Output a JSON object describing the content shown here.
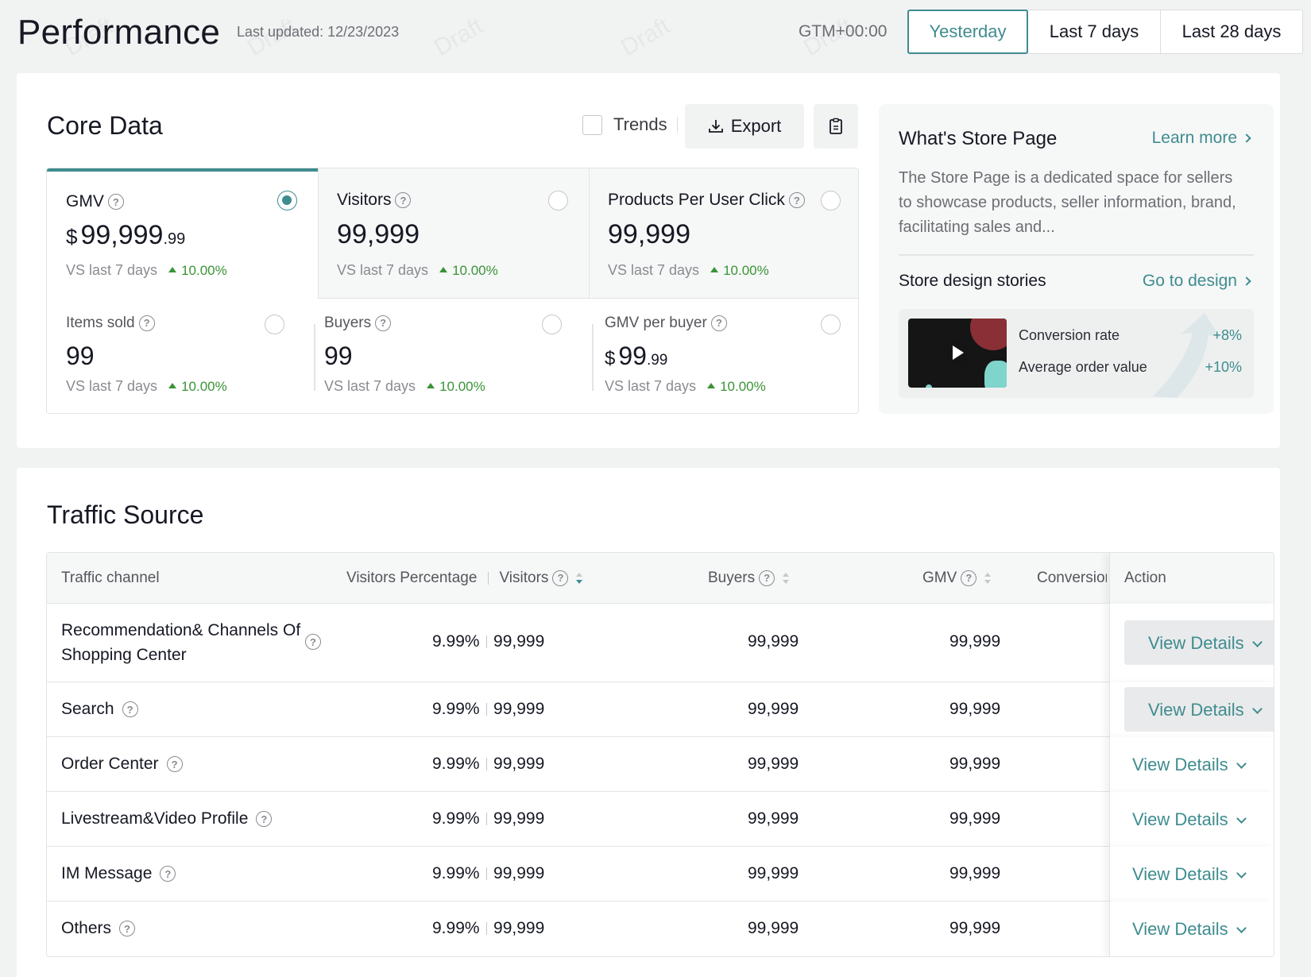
{
  "header": {
    "title": "Performance",
    "last_updated": "Last updated: 12/23/2023",
    "timezone": "GTM+00:00",
    "ranges": [
      "Yesterday",
      "Last 7 days",
      "Last 28 days"
    ],
    "watermark": "Draft"
  },
  "core": {
    "title": "Core Data",
    "trends_label": "Trends",
    "export_label": "Export",
    "metrics": [
      {
        "label": "GMV",
        "currency": "$",
        "value": "99,999",
        "decimal": ".99",
        "compare": "VS last 7 days",
        "change": "10.00%"
      },
      {
        "label": "Visitors",
        "currency": "",
        "value": "99,999",
        "decimal": "",
        "compare": "VS last 7 days",
        "change": "10.00%"
      },
      {
        "label": "Products Per User Click",
        "currency": "",
        "value": "99,999",
        "decimal": "",
        "compare": "VS last 7 days",
        "change": "10.00%"
      },
      {
        "label": "Items sold",
        "currency": "",
        "value": "99",
        "decimal": "",
        "compare": "VS last 7 days",
        "change": "10.00%"
      },
      {
        "label": "Buyers",
        "currency": "",
        "value": "99",
        "decimal": "",
        "compare": "VS last 7 days",
        "change": "10.00%"
      },
      {
        "label": "GMV per buyer",
        "currency": "$",
        "value": "99",
        "decimal": ".99",
        "compare": "VS last 7 days",
        "change": "10.00%"
      }
    ],
    "selected_metric": "GMV"
  },
  "store": {
    "title": "What's Store Page",
    "learn_more": "Learn more",
    "description": "The Store Page is a dedicated space for sellers to showcase products, seller information, brand, facilitating sales and...",
    "stories_title": "Store design stories",
    "go_to_design": "Go to design",
    "stats": [
      {
        "label": "Conversion rate",
        "value": "+8%"
      },
      {
        "label": "Average order value",
        "value": "+10%"
      }
    ]
  },
  "traffic": {
    "title": "Traffic Source",
    "columns": {
      "channel": "Traffic channel",
      "visitors_pct": "Visitors Percentage",
      "visitors": "Visitors",
      "buyers": "Buyers",
      "gmv": "GMV",
      "conversion": "Conversion",
      "action": "Action"
    },
    "rows": [
      {
        "channel": "Recommendation& Channels Of Shopping Center",
        "pct": "9.99%",
        "visitors": "99,999",
        "buyers": "99,999",
        "gmv": "99,999",
        "action": "View Details"
      },
      {
        "channel": "Search",
        "pct": "9.99%",
        "visitors": "99,999",
        "buyers": "99,999",
        "gmv": "99,999",
        "action": "View Details"
      },
      {
        "channel": "Order Center",
        "pct": "9.99%",
        "visitors": "99,999",
        "buyers": "99,999",
        "gmv": "99,999",
        "action": "View Details"
      },
      {
        "channel": "Livestream&Video Profile",
        "pct": "9.99%",
        "visitors": "99,999",
        "buyers": "99,999",
        "gmv": "99,999",
        "action": "View Details"
      },
      {
        "channel": "IM Message",
        "pct": "9.99%",
        "visitors": "99,999",
        "buyers": "99,999",
        "gmv": "99,999",
        "action": "View Details"
      },
      {
        "channel": "Others",
        "pct": "9.99%",
        "visitors": "99,999",
        "buyers": "99,999",
        "gmv": "99,999",
        "action": "View Details"
      }
    ]
  },
  "colors": {
    "accent": "#3f8c8f",
    "positive": "#3a9436",
    "text": "#161823",
    "muted": "#8a8b91"
  }
}
